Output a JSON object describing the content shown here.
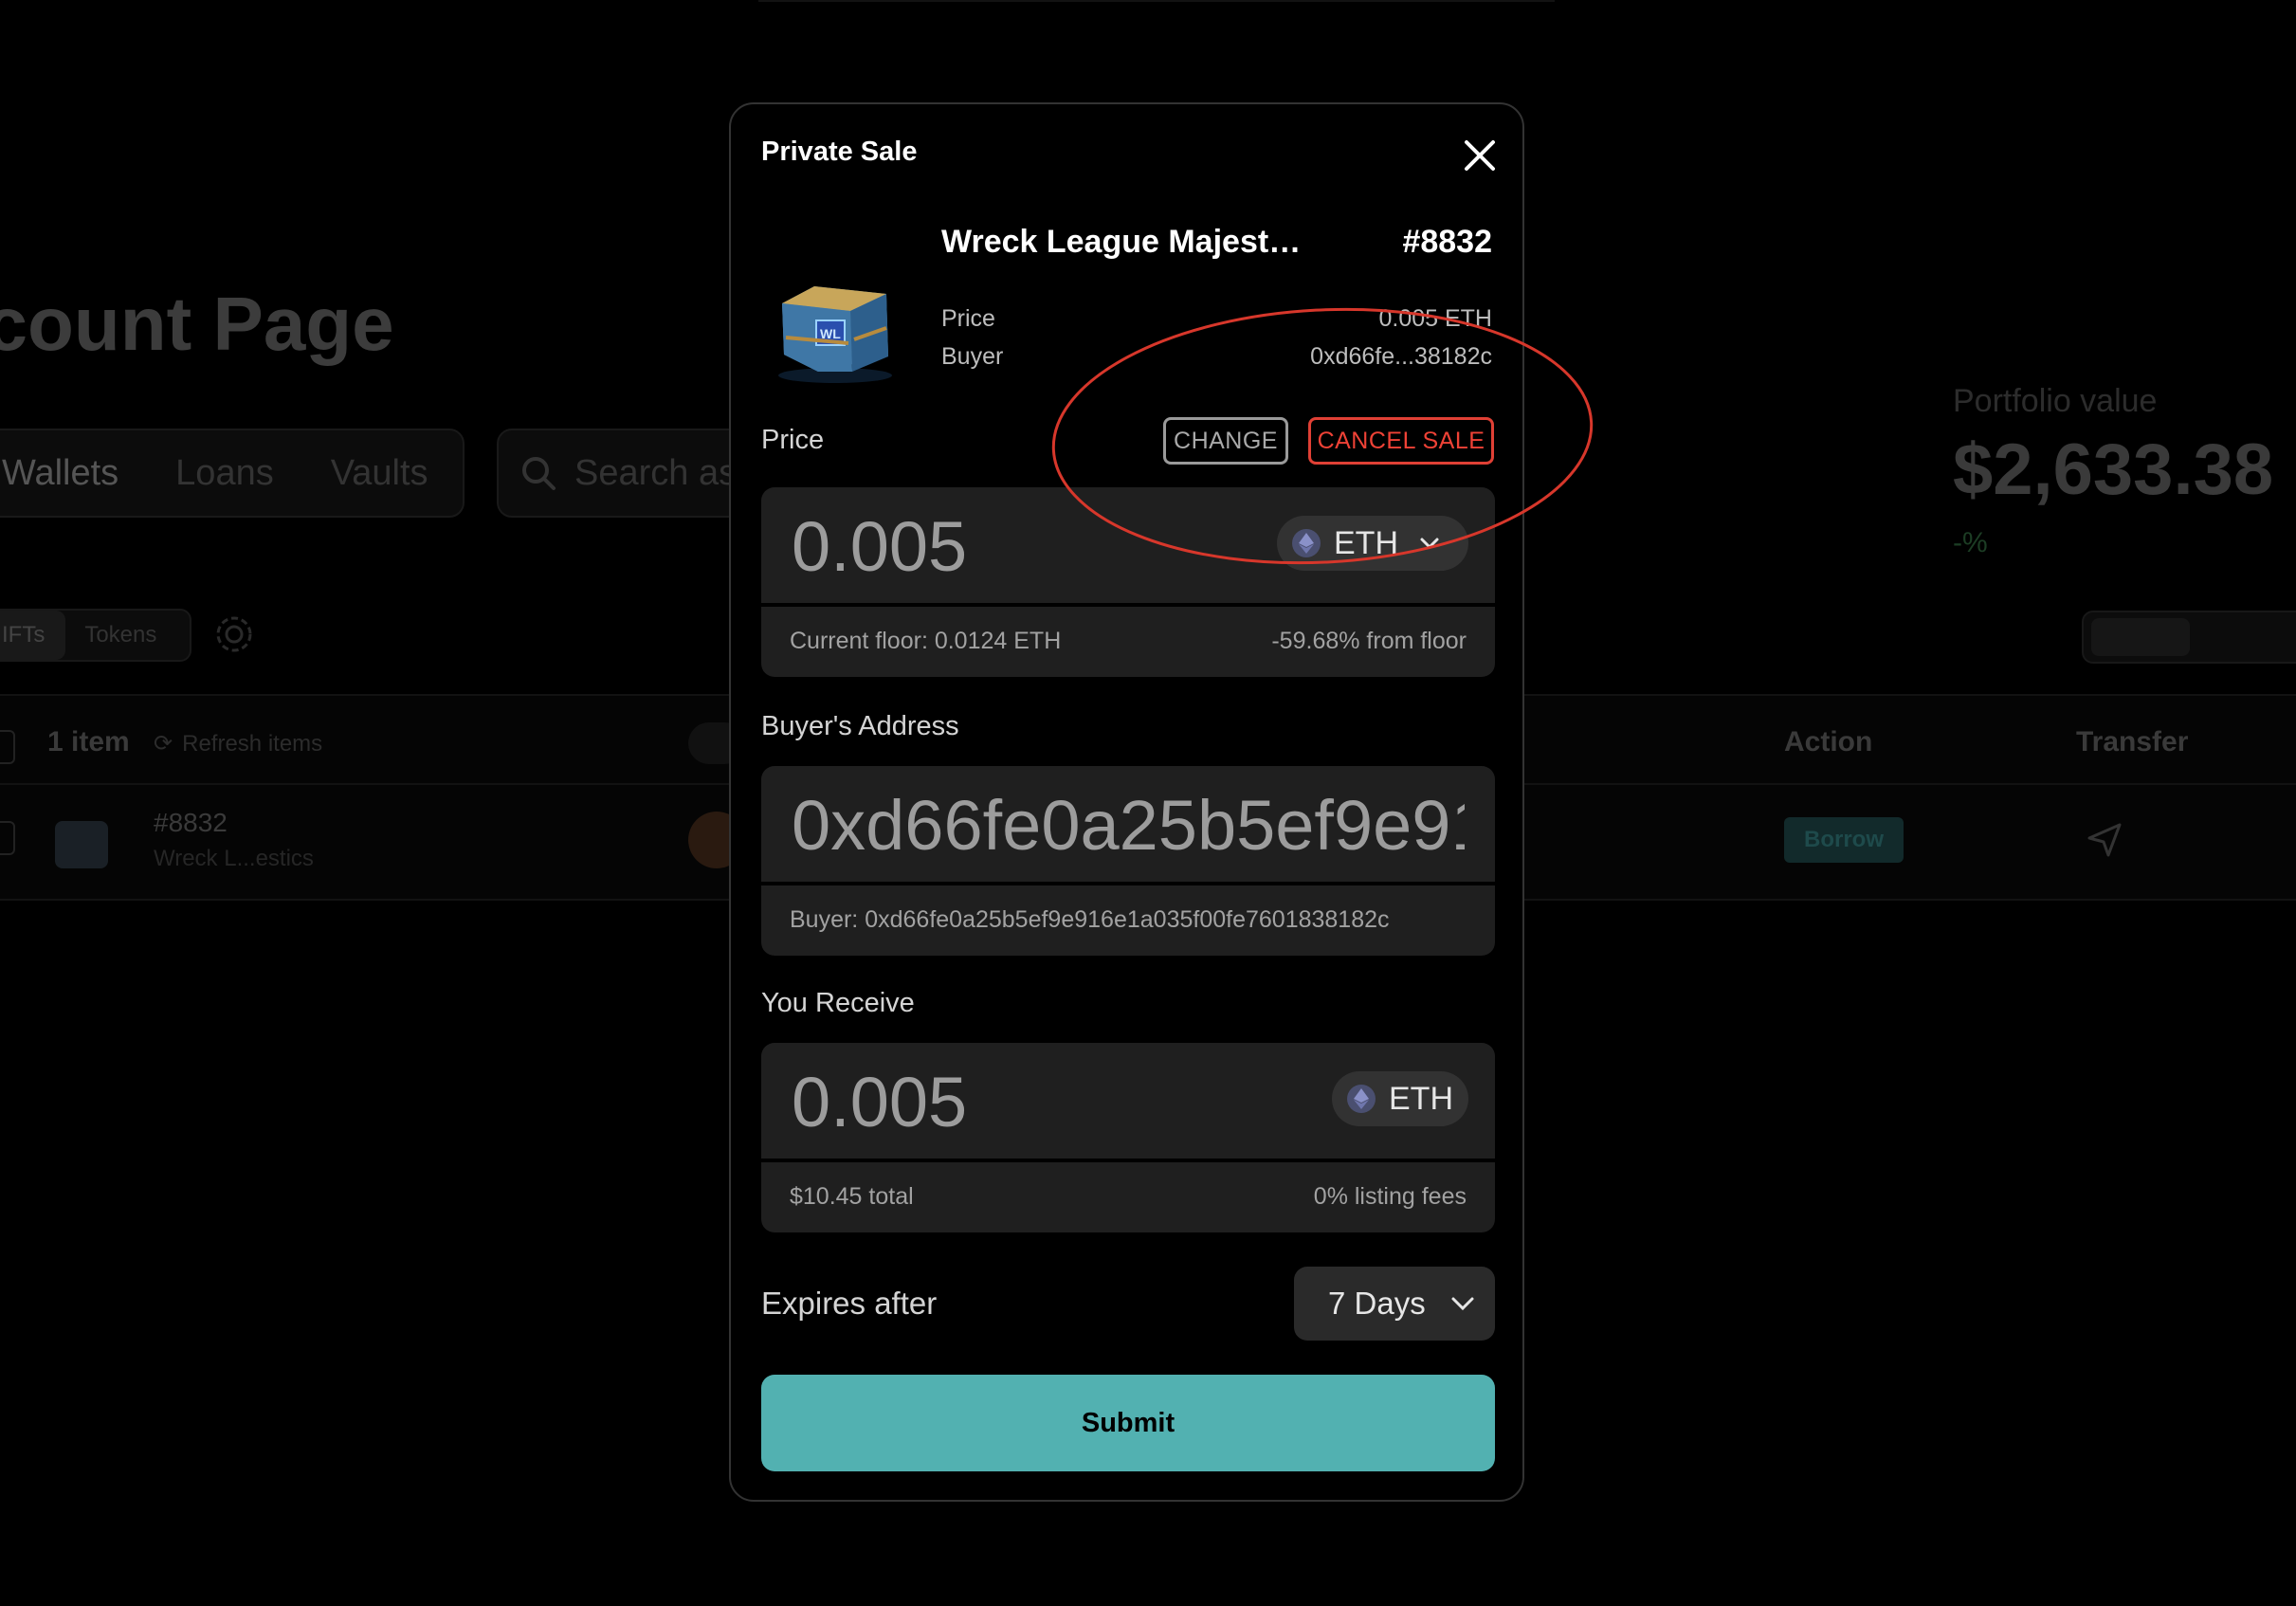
{
  "background": {
    "page_title": "ccount Page",
    "tabs": [
      "Wallets",
      "Loans",
      "Vaults"
    ],
    "search_placeholder": "Search as",
    "portfolio_label": "Portfolio value",
    "portfolio_value": "$2,633.38",
    "portfolio_change": "-%",
    "filter_tabs": [
      "IFTs",
      "Tokens"
    ],
    "table": {
      "item_count": "1 item",
      "refresh_label": "Refresh items",
      "columns": {
        "action": "Action",
        "transfer": "Transfer"
      },
      "row": {
        "id": "#8832",
        "name": "Wreck L...estics",
        "action_button": "Borrow"
      }
    }
  },
  "modal": {
    "title": "Private Sale",
    "nft": {
      "name": "Wreck League Majesti...",
      "id": "#8832",
      "price_label": "Price",
      "price_value": "0.005 ETH",
      "buyer_label": "Buyer",
      "buyer_value": "0xd66fe...38182c"
    },
    "price_section": {
      "label": "Price",
      "change_button": "CHANGE",
      "cancel_button": "CANCEL SALE",
      "amount": "0.005",
      "token": "ETH",
      "floor_text": "Current floor: 0.0124 ETH",
      "floor_diff": "-59.68% from floor"
    },
    "buyer_section": {
      "label": "Buyer's Address",
      "value": "0xd66fe0a25b5ef9e916e1a035f00fe7601838182c",
      "buyer_text": "Buyer: 0xd66fe0a25b5ef9e916e1a035f00fe7601838182c"
    },
    "receive_section": {
      "label": "You Receive",
      "amount": "0.005",
      "token": "ETH",
      "total": "$10.45 total",
      "fees": "0% listing fees"
    },
    "expires": {
      "label": "Expires after",
      "value": "7 Days"
    },
    "submit_label": "Submit"
  },
  "colors": {
    "accent": "#52b1b1",
    "cancel_red": "#ef4236",
    "annotation_red": "#d7372b"
  }
}
